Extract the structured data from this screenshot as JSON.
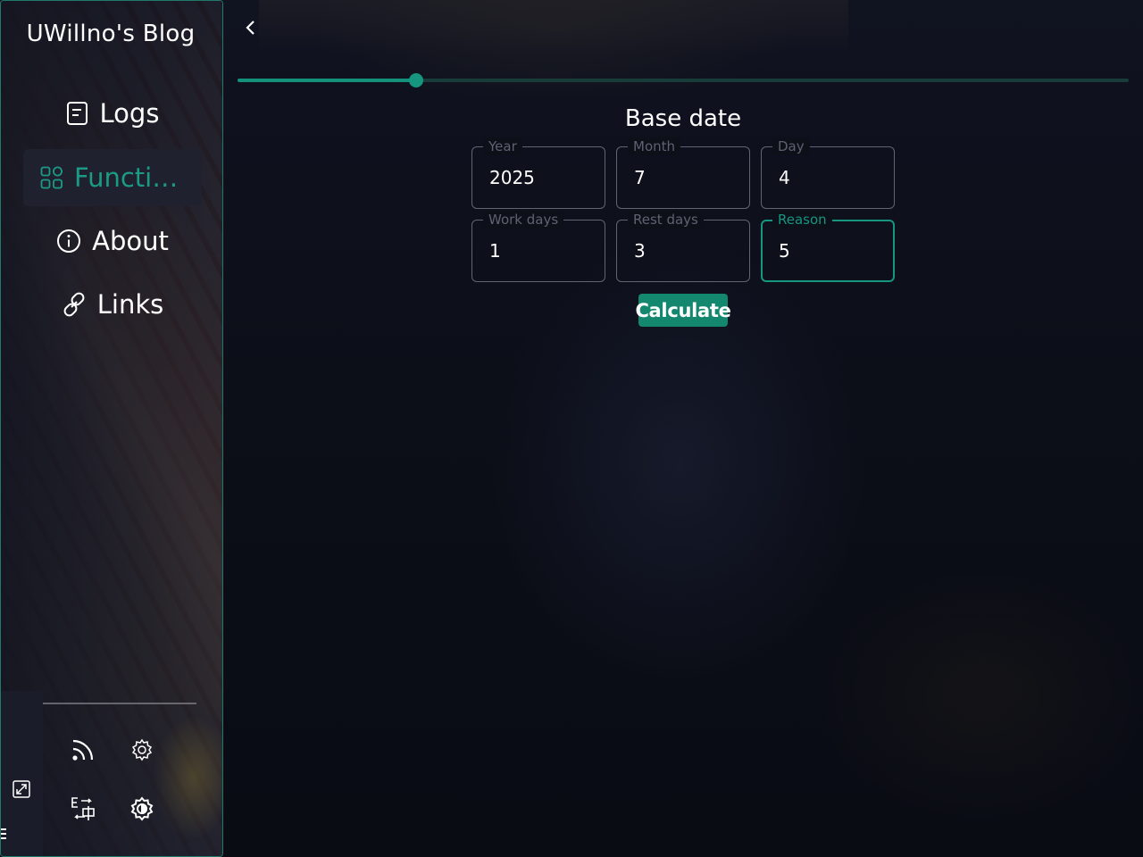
{
  "sidebar": {
    "blog_title": "UWillno's Blog",
    "nav": [
      {
        "label": "Logs",
        "icon": "document-icon",
        "active": false
      },
      {
        "label": "Functions",
        "icon": "grid-icon",
        "active": true
      },
      {
        "label": "About",
        "icon": "info-icon",
        "active": false
      },
      {
        "label": "Links",
        "icon": "link-icon",
        "active": false
      }
    ],
    "tools": [
      {
        "icon": "rss-icon"
      },
      {
        "icon": "gear-icon"
      },
      {
        "icon": "language-toggle-icon"
      },
      {
        "icon": "theme-settings-icon"
      }
    ],
    "expand_icon": "expand-icon",
    "menu_icon": "menu-icon"
  },
  "main": {
    "collapse_icon": "chevron-left-icon",
    "slider": {
      "value": 0.2
    },
    "form": {
      "title": "Base date",
      "fields": [
        {
          "label": "Year",
          "value": "2025",
          "focused": false
        },
        {
          "label": "Month",
          "value": "7",
          "focused": false
        },
        {
          "label": "Day",
          "value": "4",
          "focused": false
        },
        {
          "label": "Work days",
          "value": "1",
          "focused": false
        },
        {
          "label": "Rest days",
          "value": "3",
          "focused": false
        },
        {
          "label": "Reason",
          "value": "5",
          "focused": true
        }
      ],
      "submit_label": "Calculate"
    }
  },
  "colors": {
    "accent": "#16957f",
    "sidebar_border": "#1f7a6c",
    "background": "#0c0e18",
    "button": "#13886f"
  }
}
